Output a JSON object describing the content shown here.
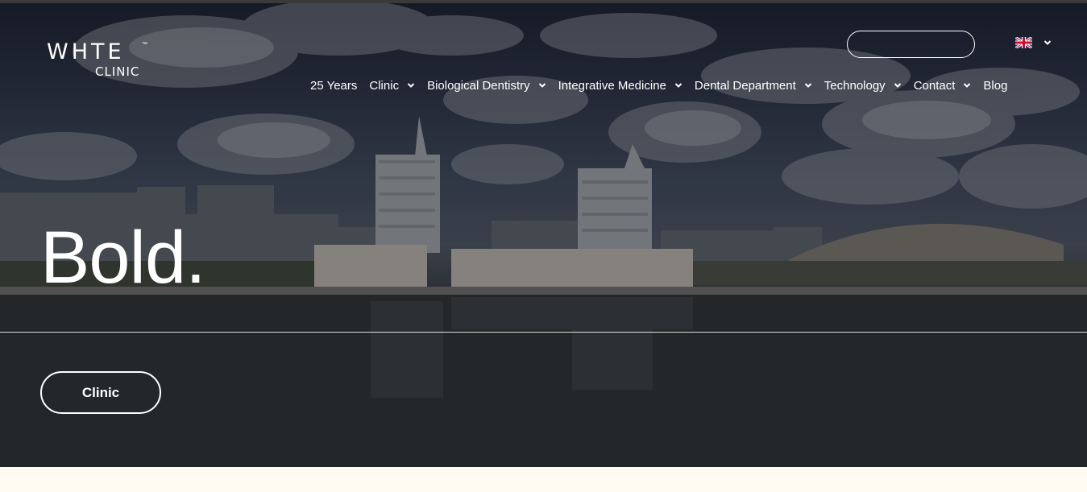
{
  "brand": {
    "logo_word": "WHTE",
    "logo_tm": "™",
    "logo_sub": "CLINIC"
  },
  "header": {
    "search_placeholder": "",
    "language": "English",
    "nav": [
      {
        "label": "25 Years",
        "has_dropdown": false
      },
      {
        "label": "Clinic",
        "has_dropdown": true
      },
      {
        "label": "Biological Dentistry",
        "has_dropdown": true
      },
      {
        "label": "Integrative Medicine",
        "has_dropdown": true
      },
      {
        "label": "Dental Department",
        "has_dropdown": true
      },
      {
        "label": "Technology",
        "has_dropdown": true
      },
      {
        "label": "Contact",
        "has_dropdown": true
      },
      {
        "label": "Blog",
        "has_dropdown": false
      }
    ]
  },
  "hero": {
    "headline": "Bold.",
    "cta_label": "Clinic"
  },
  "colors": {
    "text": "#ffffff",
    "page_background": "#fffbf2",
    "topbar": "#3a3a3a"
  },
  "icons": {
    "flag": "uk-flag-icon",
    "dropdown": "chevron-down-icon"
  }
}
